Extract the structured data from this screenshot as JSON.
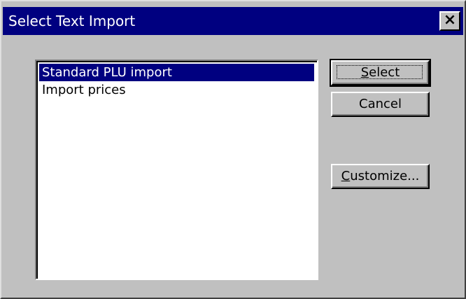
{
  "window": {
    "title": "Select Text Import",
    "close_glyph": "×"
  },
  "list": {
    "items": [
      {
        "label": "Standard PLU import",
        "selected": true
      },
      {
        "label": "Import prices",
        "selected": false
      }
    ]
  },
  "buttons": {
    "select": {
      "accel": "S",
      "rest": "elect"
    },
    "cancel": {
      "label": "Cancel"
    },
    "customize": {
      "accel": "C",
      "rest": "ustomize..."
    }
  },
  "colors": {
    "titlebar": "#000080",
    "face": "#c0c0c0",
    "selection": "#000080"
  }
}
